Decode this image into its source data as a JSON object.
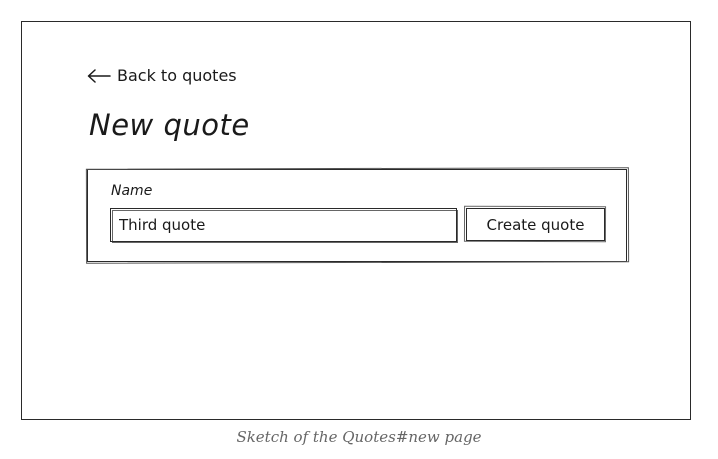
{
  "back_link": {
    "label": "Back to quotes",
    "icon": "arrow-left-icon"
  },
  "page": {
    "title": "New quote"
  },
  "form": {
    "name_label": "Name",
    "name_value": "Third quote",
    "submit_label": "Create quote"
  },
  "caption": "Sketch of the Quotes#new page"
}
